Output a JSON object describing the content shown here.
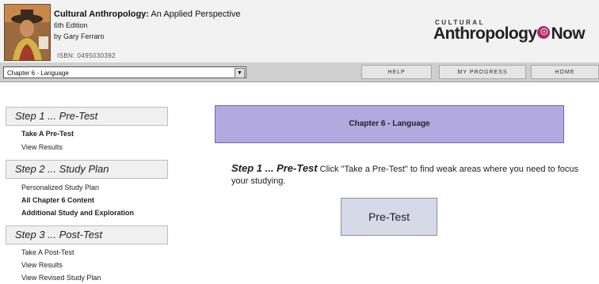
{
  "header": {
    "title_bold": "Cultural Anthropology:",
    "title_rest": " An Applied Perspective",
    "edition": "6th Edition",
    "author": "by Gary Ferraro",
    "isbn": "ISBN: 0495030392",
    "brand_small": "CULTURAL",
    "brand_main_left": "Anthropology",
    "brand_circle": "☉",
    "brand_main_right": "Now"
  },
  "nav": {
    "chapter_select": "Chapter 6 - Language",
    "help": "HELP",
    "my_progress": "MY PROGRESS",
    "home": "HOME"
  },
  "sidebar": {
    "step1": {
      "title": "Step 1 ... Pre-Test",
      "links": [
        "Take A Pre-Test",
        "View Results"
      ]
    },
    "step2": {
      "title": "Step 2 ... Study Plan",
      "links": [
        "Personalized Study Plan",
        "All Chapter 6 Content",
        "Additional Study and Exploration"
      ]
    },
    "step3": {
      "title": "Step 3 ... Post-Test",
      "links": [
        "Take A Post-Test",
        "View Results",
        "View Revised Study Plan"
      ]
    }
  },
  "main": {
    "banner": "Chapter 6 - Language",
    "instruction_lead": "Step 1 ... Pre-Test",
    "instruction_text": " Click \"Take a Pre-Test\" to find weak areas where you need to focus your studying.",
    "pretest_button": "Pre-Test"
  }
}
